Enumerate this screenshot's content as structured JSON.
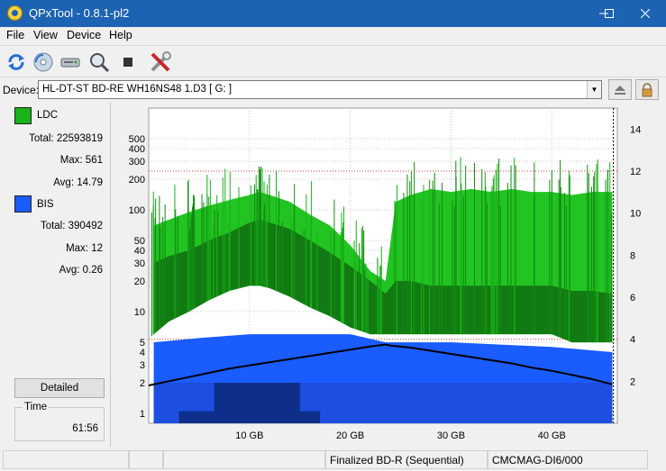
{
  "window": {
    "title": "QPxTool - 0.8.1-pl2"
  },
  "menu": {
    "file": "File",
    "view": "View",
    "device": "Device",
    "help": "Help"
  },
  "device": {
    "label": "Device:",
    "value": "HL-DT-ST BD-RE  WH16NS48  1.D3 [ G: ]"
  },
  "ldc": {
    "name": "LDC",
    "color": "#19b219",
    "total": "Total: 22593819",
    "max": "Max: 561",
    "avg": "Avg: 14.79"
  },
  "bis": {
    "name": "BIS",
    "color": "#1a5cff",
    "total": "Total: 390492",
    "max": "Max: 12",
    "avg": "Avg: 0.26"
  },
  "buttons": {
    "detailed": "Detailed"
  },
  "time": {
    "label": "Time",
    "value": "61:56"
  },
  "status": {
    "cell1": "",
    "cell2": "",
    "cell3": "Finalized BD-R (Sequential)",
    "cell4": "CMCMAG-DI6/000"
  },
  "chart_data": {
    "type": "area",
    "xlim": [
      0,
      46.5
    ],
    "x_unit": "GB",
    "left_scale": "log",
    "ylim_left": [
      0.8,
      1000
    ],
    "ylim_right": [
      0,
      15
    ],
    "x_ticks": [
      "10 GB",
      "20 GB",
      "30 GB",
      "40 GB"
    ],
    "x_tick_values": [
      10,
      20,
      30,
      40
    ],
    "y_left_ticks": [
      "1",
      "2",
      "3",
      "4",
      "5",
      "10",
      "20",
      "30",
      "40",
      "50",
      "100",
      "200",
      "300",
      "400",
      "500"
    ],
    "y_left_values": [
      1,
      2,
      3,
      4,
      5,
      10,
      20,
      30,
      40,
      50,
      100,
      200,
      300,
      400,
      500
    ],
    "y_right_ticks": [
      "2",
      "4",
      "6",
      "8",
      "10",
      "12",
      "14"
    ],
    "y_right_values": [
      2,
      4,
      6,
      8,
      10,
      12,
      14
    ],
    "ldc_series": {
      "x": [
        0.5,
        2,
        4,
        6,
        8,
        10,
        11,
        12,
        14,
        16,
        18,
        20,
        22,
        23.5,
        24.5,
        26,
        28,
        30,
        32,
        34,
        36,
        38,
        40,
        42,
        44,
        46
      ],
      "peak": [
        70,
        80,
        95,
        110,
        125,
        140,
        150,
        140,
        120,
        90,
        70,
        45,
        25,
        20,
        120,
        140,
        160,
        150,
        160,
        150,
        160,
        150,
        150,
        140,
        150,
        150
      ],
      "high": [
        30,
        35,
        40,
        50,
        60,
        75,
        80,
        75,
        65,
        50,
        38,
        28,
        20,
        15,
        20,
        20,
        18,
        18,
        18,
        18,
        18,
        18,
        18,
        16,
        16,
        15
      ],
      "low": [
        6,
        8,
        10,
        13,
        16,
        18,
        18,
        17,
        14,
        11,
        9,
        7,
        6,
        6,
        6,
        6,
        6,
        6,
        6,
        6,
        6,
        6,
        6,
        5,
        5,
        5
      ]
    },
    "bis_series": {
      "x": [
        0.5,
        5,
        10,
        20,
        23.5,
        30,
        40,
        46
      ],
      "upper": [
        5,
        5.5,
        6,
        6,
        5,
        5,
        4.5,
        4
      ],
      "lower": [
        2,
        2,
        2,
        2,
        2,
        2,
        2,
        2
      ]
    },
    "speed_series": {
      "x": [
        0,
        2,
        4,
        6,
        8,
        10,
        12,
        14,
        16,
        18,
        20,
        22,
        23.5,
        24,
        26,
        28,
        30,
        32,
        34,
        36,
        38,
        40,
        42,
        44,
        46
      ],
      "y": [
        1.8,
        2.0,
        2.2,
        2.4,
        2.6,
        2.75,
        2.9,
        3.05,
        3.2,
        3.35,
        3.5,
        3.65,
        3.75,
        3.7,
        3.6,
        3.45,
        3.3,
        3.15,
        3.0,
        2.85,
        2.65,
        2.5,
        2.3,
        2.1,
        1.85
      ]
    }
  }
}
